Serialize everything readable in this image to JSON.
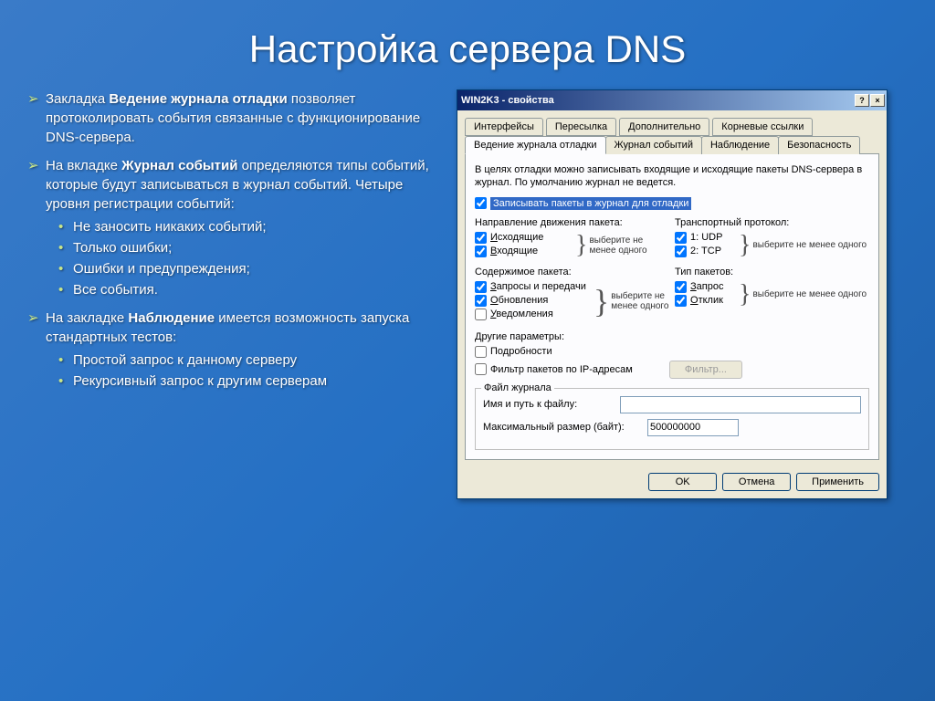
{
  "slide": {
    "title": "Настройка сервера DNS",
    "items": [
      {
        "pre": "Закладка ",
        "bold": "Ведение журнала отладки",
        "post": " позволяет протоколировать события связанные с функционирование DNS-сервера."
      },
      {
        "pre": "На вкладке ",
        "bold": "Журнал событий",
        "post": " определяются типы событий, которые будут записываться в журнал событий. Четыре уровня регистрации событий:",
        "subs": [
          "Не заносить никаких событий;",
          "Только ошибки;",
          "Ошибки и предупреждения;",
          "Все события."
        ]
      },
      {
        "pre": "На закладке ",
        "bold": "Наблюдение",
        "post": " имеется возможность запуска стандартных тестов:",
        "subs": [
          "Простой запрос  к данному серверу",
          "Рекурсивный запрос к другим серверам"
        ]
      }
    ]
  },
  "dialog": {
    "title": "WIN2K3 - свойства",
    "help_btn": "?",
    "close_btn": "×",
    "tabs_top": [
      "Интерфейсы",
      "Пересылка",
      "Дополнительно",
      "Корневые ссылки"
    ],
    "tabs_bottom": [
      "Ведение журнала отладки",
      "Журнал событий",
      "Наблюдение",
      "Безопасность"
    ],
    "desc": "В целях отладки можно записывать входящие и исходящие пакеты DNS-сервера в журнал. По умолчанию журнал не ведется.",
    "main_check": "Записывать пакеты в журнал для отладки",
    "direction": {
      "title": "Направление движения пакета:",
      "items": [
        "Исходящие",
        "Входящие"
      ]
    },
    "transport": {
      "title": "Транспортный протокол:",
      "items": [
        "1: UDP",
        "2: TCP"
      ]
    },
    "content": {
      "title": "Содержимое пакета:",
      "items": [
        "Запросы и передачи",
        "Обновления",
        "Уведомления"
      ],
      "checked": [
        true,
        true,
        false
      ]
    },
    "pkttype": {
      "title": "Тип пакетов:",
      "items": [
        "Запрос",
        "Отклик"
      ]
    },
    "hint": "выберите не менее одного",
    "other_title": "Другие параметры:",
    "other_items": [
      "Подробности",
      "Фильтр пакетов по IP-адресам"
    ],
    "filter_btn": "Фильтр...",
    "file_group": "Файл журнала",
    "file_path_label": "Имя и путь к файлу:",
    "file_path_value": "",
    "max_size_label": "Максимальный размер (байт):",
    "max_size_value": "500000000",
    "buttons": {
      "ok": "OK",
      "cancel": "Отмена",
      "apply": "Применить"
    }
  }
}
